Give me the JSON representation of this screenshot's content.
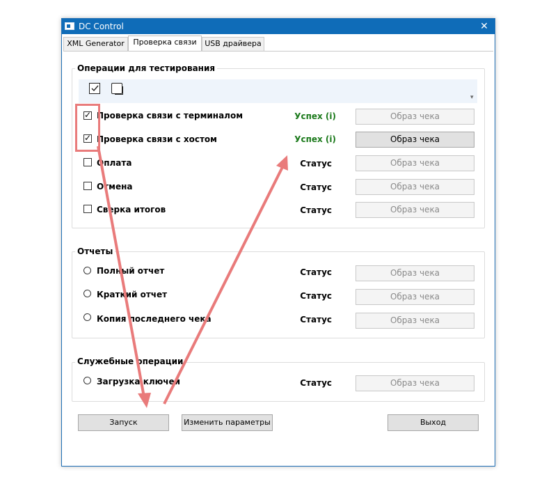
{
  "window": {
    "title": "DC Control",
    "close": "✕"
  },
  "tabs": [
    {
      "label": "XML Generator"
    },
    {
      "label": "Проверка связи"
    },
    {
      "label": "USB драйвера"
    }
  ],
  "groups": {
    "test_ops": {
      "title": "Операции для тестирования",
      "rows": [
        {
          "label": "Проверка связи с терминалом",
          "checked": true,
          "status": "Успех (i)",
          "receipt": "Образ чека"
        },
        {
          "label": "Проверка связи с хостом",
          "checked": true,
          "status": "Успех (i)",
          "receipt": "Образ чека"
        },
        {
          "label": "Оплата",
          "checked": false,
          "status": "Статус",
          "receipt": "Образ чека"
        },
        {
          "label": "Отмена",
          "checked": false,
          "status": "Статус",
          "receipt": "Образ чека"
        },
        {
          "label": "Сверка итогов",
          "checked": false,
          "status": "Статус",
          "receipt": "Образ чека"
        }
      ]
    },
    "reports": {
      "title": "Отчеты",
      "rows": [
        {
          "label": "Полный отчет",
          "status": "Статус",
          "receipt": "Образ чека"
        },
        {
          "label": "Краткий отчет",
          "status": "Статус",
          "receipt": "Образ чека"
        },
        {
          "label": "Копия последнего чека",
          "status": "Статус",
          "receipt": "Образ чека"
        }
      ]
    },
    "service": {
      "title": "Служебные операции",
      "rows": [
        {
          "label": "Загрузка ключей",
          "status": "Статус",
          "receipt": "Образ чека"
        }
      ]
    }
  },
  "buttons": {
    "run": "Запуск",
    "change_params": "Изменить параметры",
    "exit": "Выход"
  },
  "colors": {
    "titlebar": "#0f6cb8",
    "success": "#1c7a1c",
    "annotation": "#e97b7b"
  }
}
